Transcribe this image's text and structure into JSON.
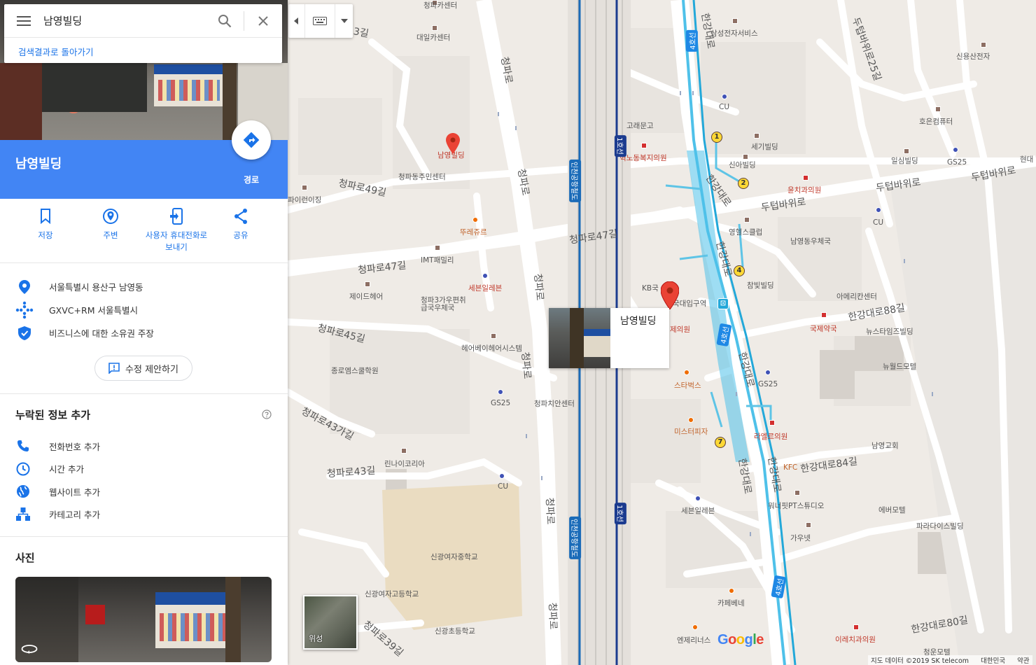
{
  "search": {
    "query": "남영빌딩",
    "back_link": "검색결과로 돌아가기"
  },
  "place": {
    "title": "남영빌딩",
    "route_label": "경로"
  },
  "actions": [
    {
      "label": "저장",
      "icon": "bookmark-icon"
    },
    {
      "label": "주변",
      "icon": "nearby-icon"
    },
    {
      "label": "사용자 휴대전화로 보내기",
      "icon": "send-to-phone-icon"
    },
    {
      "label": "공유",
      "icon": "share-icon"
    }
  ],
  "info": {
    "address": "서울특별시 용산구 남영동",
    "plus_code": "GXVC+RM 서울특별시",
    "claim": "비즈니스에 대한 소유권 주장"
  },
  "suggest_edit": "수정 제안하기",
  "missing_info": {
    "title": "누락된 정보 추가",
    "items": [
      "전화번호 추가",
      "시간 추가",
      "웹사이트 추가",
      "카테고리 추가"
    ]
  },
  "photos": {
    "title": "사진"
  },
  "map": {
    "card_title": "남영빌딩",
    "satellite_label": "위성",
    "logo": "Google",
    "attribution": {
      "data": "지도 데이터 ©2019 SK telecom",
      "region": "대한민국",
      "terms": "약관"
    },
    "roads": [
      "청파로49길",
      "청파로47길",
      "청파로47길",
      "청파로45길",
      "청파로43가길",
      "청파로43길",
      "청파로39길",
      "청파로",
      "청파로",
      "청파로",
      "청파로",
      "청파로",
      "청파로",
      "한강대로",
      "한강대로",
      "한강대로",
      "한강대로",
      "한강대로",
      "한강대로",
      "두텁바위로",
      "두텁바위로",
      "두텁바위로",
      "두텁바위로25길",
      "한강대로88길",
      "한강대로84길",
      "한강대로80길",
      "3길"
    ],
    "places": [
      "청파카센터",
      "대일카센터",
      "삼성전자서비스",
      "신용산전자",
      "호은컴퓨터",
      "CU",
      "고래문고",
      "세기빌딩",
      "신아빌딩",
      "일심빌딩",
      "GS25",
      "현대",
      "남영빌딩",
      "청파동주민센터",
      "혁노동복지의원",
      "윤치과의원",
      "파이런이징",
      "뚜레쥬르",
      "영헬스클럽",
      "남영동우체국",
      "CU",
      "IMT패밀리",
      "세븐일레븐",
      "KB국",
      "참빛빌딩",
      "아메리칸센터",
      "제이드헤어",
      "청파3가우편취급국우체국",
      "국대입구역",
      "국제약국",
      "뉴스타임즈빌딩",
      "헤어베이헤어시스템",
      "제의원",
      "뉴월드모텔",
      "종로엠스쿨학원",
      "스타벅스",
      "GS25",
      "GS25",
      "청파치안센터",
      "라엘르의원",
      "미스터피자",
      "남영교회",
      "린나이코리아",
      "KFC",
      "CU",
      "워너핏PT스튜디오",
      "에버모텔",
      "세븐일레븐",
      "가우넷",
      "파라다이스빌딩",
      "신광여자중학교",
      "신광여자고등학교",
      "카페베네",
      "신광초등학교",
      "엔제리너스",
      "이레치과의원",
      "청운모텔"
    ],
    "line_labels": [
      "4호선",
      "4호선",
      "4호선",
      "1호선",
      "1호선",
      "인천공항철도",
      "인천공항철도"
    ],
    "exits": [
      "1",
      "2",
      "4",
      "7"
    ]
  }
}
